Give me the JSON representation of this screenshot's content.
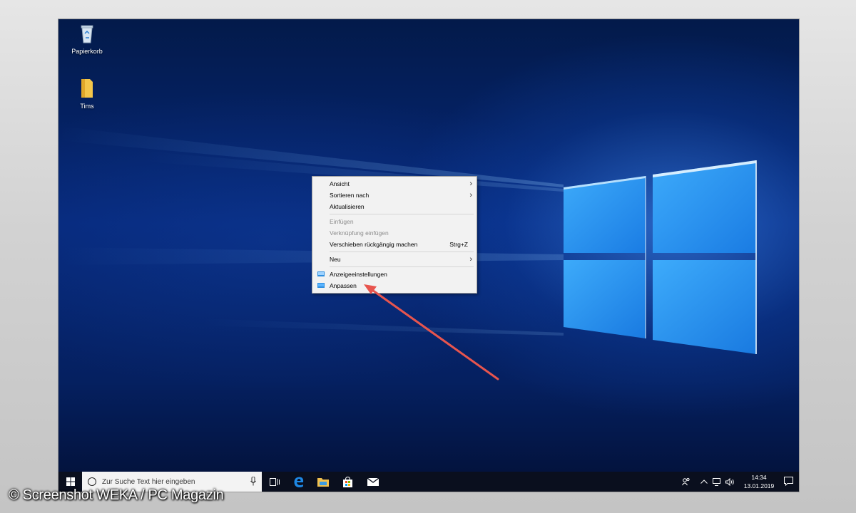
{
  "desktop": {
    "icons": [
      {
        "label": "Papierkorb",
        "icon": "recycle-bin-icon"
      },
      {
        "label": "Tims",
        "icon": "folder-icon"
      }
    ]
  },
  "context_menu": {
    "items": [
      {
        "label": "Ansicht",
        "submenu": true,
        "disabled": false
      },
      {
        "label": "Sortieren nach",
        "submenu": true,
        "disabled": false
      },
      {
        "label": "Aktualisieren",
        "disabled": false
      },
      {
        "label": "Einfügen",
        "disabled": true
      },
      {
        "label": "Verknüpfung einfügen",
        "disabled": true
      },
      {
        "label": "Verschieben rückgängig machen",
        "shortcut": "Strg+Z",
        "disabled": false
      },
      {
        "label": "Neu",
        "submenu": true,
        "disabled": false
      },
      {
        "label": "Anzeigeeinstellungen",
        "icon": "display-settings-icon",
        "disabled": false
      },
      {
        "label": "Anpassen",
        "icon": "personalize-icon",
        "disabled": false
      }
    ]
  },
  "taskbar": {
    "search_placeholder": "Zur Suche Text hier eingeben",
    "pinned": [
      "task-view-icon",
      "edge-icon",
      "file-explorer-icon",
      "store-icon",
      "mail-icon"
    ],
    "tray": [
      "people-icon",
      "chevron-up-icon",
      "network-icon",
      "volume-icon"
    ],
    "time": "14:34",
    "date": "13.01.2019"
  },
  "watermark": "© Screenshot WEKA / PC Magazin",
  "colors": {
    "annotation_arrow": "#e8554e",
    "taskbar": "#0a0f1e",
    "accent": "#0078d7"
  }
}
